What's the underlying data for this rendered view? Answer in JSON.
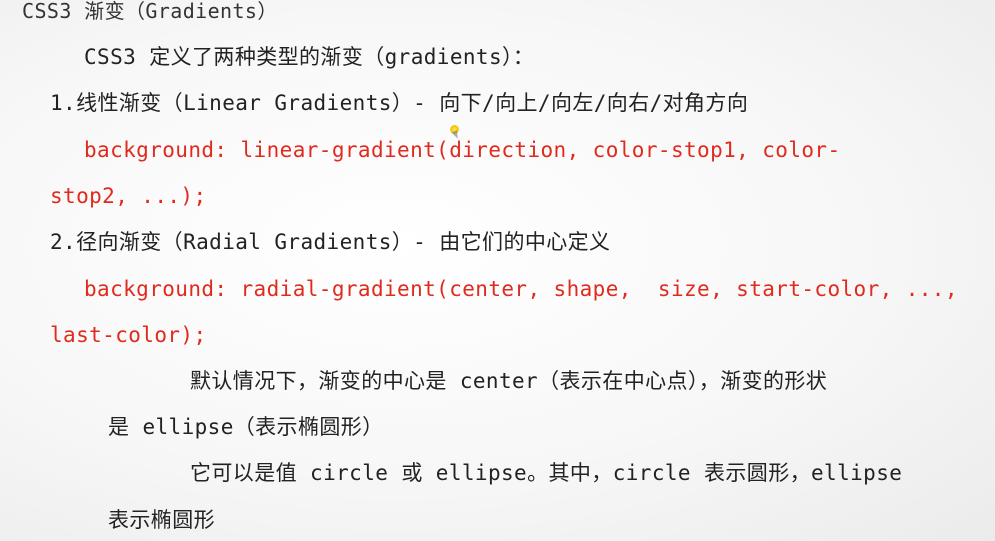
{
  "slide": {
    "title": "CSS3 渐变（Gradients）",
    "intro": "CSS3 定义了两种类型的渐变（gradients）：",
    "linear": {
      "heading": "1.线性渐变（Linear Gradients）- 向下/向上/向左/向右/对角方向",
      "code_line1": "background: linear-gradient(direction, color-stop1, color-",
      "code_line2": "stop2, ...);"
    },
    "radial": {
      "heading": "2.径向渐变（Radial Gradients）- 由它们的中心定义",
      "code_line1": "background: radial-gradient(center, shape,  size, start-color, ...,",
      "code_line2": "last-color);",
      "note1_line1": "默认情况下，渐变的中心是 center（表示在中心点），渐变的形状",
      "note1_line2": "是 ellipse（表示椭圆形）",
      "note2_line1": "它可以是值 circle 或 ellipse。其中，circle 表示圆形，ellipse",
      "note2_line2": "表示椭圆形"
    }
  },
  "colors": {
    "code": "#e02a1d",
    "text": "#222222"
  }
}
